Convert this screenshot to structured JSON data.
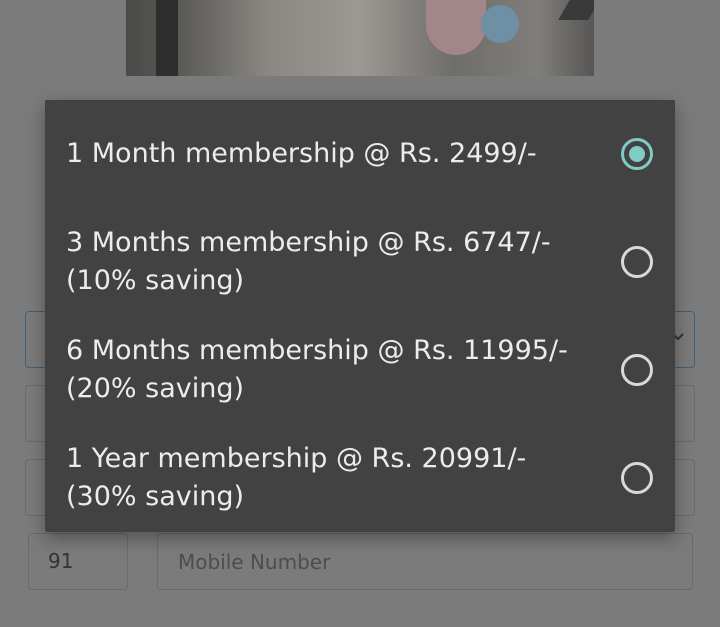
{
  "form": {
    "country_code": "91",
    "mobile_placeholder": "Mobile Number"
  },
  "membership_options": [
    {
      "line1": "1 Month membership @ Rs. 2499/-",
      "line2": "",
      "selected": true
    },
    {
      "line1": "3 Months membership @ Rs. 6747/-",
      "line2": "(10% saving)",
      "selected": false
    },
    {
      "line1": "6 Months membership @ Rs. 11995/-",
      "line2": "(20% saving)",
      "selected": false
    },
    {
      "line1": "1 Year membership @ Rs. 20991/-",
      "line2": "(30% saving)",
      "selected": false
    }
  ],
  "colors": {
    "dialog_bg": "#424242",
    "accent": "#80cbc4",
    "text": "#ececec"
  }
}
